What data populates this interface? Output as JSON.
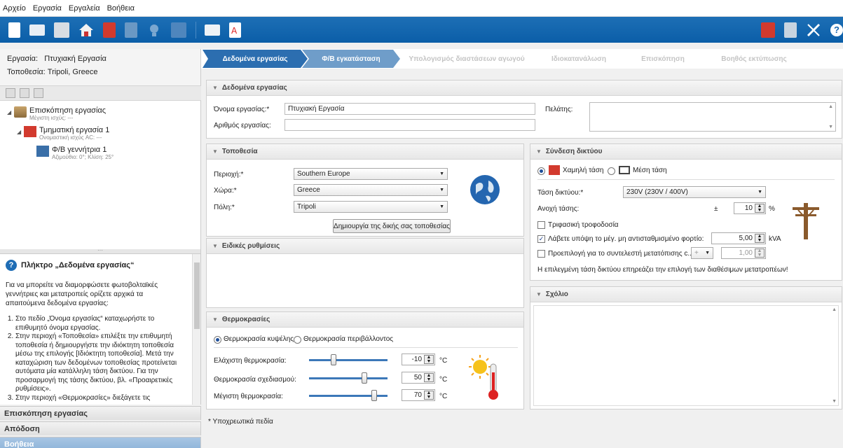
{
  "menu": [
    "Αρχείο",
    "Εργασία",
    "Εργαλεία",
    "Βοήθεια"
  ],
  "toolbar": {
    "icons": [
      "new-file-icon",
      "open-folder-icon",
      "save-icon",
      "home-icon",
      "inverter-icon",
      "grid-icon",
      "bulb-icon",
      "pv-array-icon",
      "print-icon",
      "pdf-icon"
    ],
    "right_icons": [
      "red-device-icon",
      "module-grid-icon",
      "tools-icon",
      "help-icon"
    ],
    "bg": "#1565b0"
  },
  "project": {
    "label_task": "Εργασία:",
    "task_value": "Πτυχιακή Εργασία",
    "label_location": "Τοποθεσία:",
    "location_value": "Tripoli, Greece"
  },
  "tree": [
    {
      "title": "Επισκόπηση εργασίας",
      "sub": "Μέγιστη ισχύς: ---"
    },
    {
      "title": "Τμηματική εργασία 1",
      "sub": "Ονομαστική ισχύς AC: ---"
    },
    {
      "title": "Φ/Β γεννήτρια 1",
      "sub": "Αζιμούθιο: 0°; Κλίση: 25°"
    }
  ],
  "help": {
    "title": "Πλήκτρο „Δεδομένα εργασίας“",
    "intro": "Για να μπορείτε να διαμορφώσετε φωτοβολταϊκές γεννήτριες και μετατροπείς ορίζετε αρχικά τα απαιτούμενα δεδομένα εργασίας:",
    "items": [
      "Στο πεδίο „Όνομα εργασίας“ καταχωρήστε το επιθυμητό όνομα εργασίας.",
      "Στην περιοχή «Τοποθεσία» επιλέξτε την επιθυμητή τοποθεσία ή δημιουργήστε την ιδιόκτητη τοποθεσία μέσω της επιλογής [Ιδιόκτητη τοποθεσία]. Μετά την καταχώριση των δεδομένων τοποθεσίας προτείνεται αυτόματα μία κατάλληλη τάση δικτύου. Για την προσαρμογή της τάσης δικτύου, βλ. «Προαιρετικές ρυθμίσεις».",
      "Στην περιοχή «Θερμοκρασίες» διεξάγετε τις"
    ]
  },
  "accordion": [
    "Επισκόπηση εργασίας",
    "Απόδοση",
    "Βοήθεια"
  ],
  "steps": [
    "Δεδομένα εργασίας",
    "Φ/Β εγκατάσταση",
    "Υπολογισμός διαστάσεων αγωγού",
    "Ιδιοκατανάλωση",
    "Επισκόπηση",
    "Βοηθός εκτύπωσης"
  ],
  "project_panel": {
    "title": "Δεδομένα εργασίας",
    "name_label": "Όνομα εργασίας:*",
    "name_value": "Πτυχιακή Εργασία",
    "number_label": "Αριθμός εργασίας:",
    "number_value": "",
    "client_label": "Πελάτης:"
  },
  "location_panel": {
    "title": "Τοποθεσία",
    "region_label": "Περιοχή:*",
    "region_value": "Southern Europe",
    "country_label": "Χώρα:*",
    "country_value": "Greece",
    "city_label": "Πόλη:*",
    "city_value": "Tripoli",
    "create_button": "Δημιουργία της δικής σας τοποθεσίας"
  },
  "special_panel": {
    "title": "Ειδικές ρυθμίσεις"
  },
  "temp_panel": {
    "title": "Θερμοκρασίες",
    "radio_cell": "Θερμοκρασία κυψέλης",
    "radio_ambient": "Θερμοκρασία περιβάλλοντος",
    "min_label": "Ελάχιστη θερμοκρασία:",
    "min_value": "-10",
    "design_label": "Θερμοκρασία σχεδιασμού:",
    "design_value": "50",
    "max_label": "Μέγιστη θερμοκρασία:",
    "max_value": "70",
    "unit": "°C",
    "min_level": 0.3,
    "design_level": 0.72,
    "max_level": 0.86
  },
  "grid_panel": {
    "title": "Σύνδεση δικτύου",
    "low_voltage": "Χαμηλή τάση",
    "medium_voltage": "Μέση τάση",
    "voltage_label": "Τάση δικτύου:*",
    "voltage_value": "230V (230V / 400V)",
    "tolerance_label": "Ανοχή τάσης:",
    "tolerance_sign": "±",
    "tolerance_value": "10",
    "tolerance_unit": "%",
    "three_phase": "Τριφασική τροφοδοσία",
    "unbalanced_label": "Λάβετε υπόψη το μέγ. μη αντισταθμισμένο φορτίο:",
    "unbalanced_value": "5,00",
    "unbalanced_unit": "kVA",
    "phase_label": "Προεπιλογή για το συντελεστή μετατόπισης c...",
    "phase_sign": "+",
    "phase_value": "1,00",
    "note": "Η επιλεγμένη τάση δικτύου επηρεάζει την επιλογή των διαθέσιμων μετατροπέων!"
  },
  "comment_panel": {
    "title": "Σχόλιο"
  },
  "footnote": "* Υποχρεωτικά πεδία"
}
